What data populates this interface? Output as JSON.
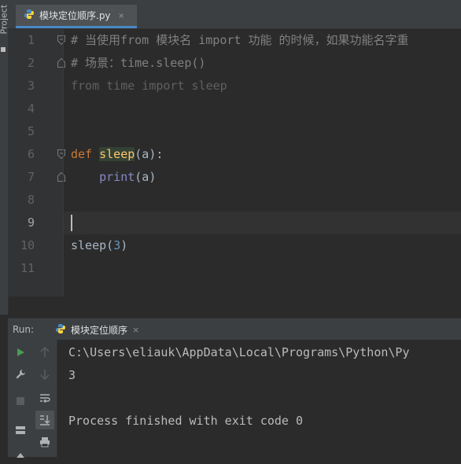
{
  "sidebar": {
    "project_label": "Project"
  },
  "tabs": [
    {
      "label": "模块定位顺序.py",
      "close": "×"
    }
  ],
  "editor": {
    "line_numbers": [
      "1",
      "2",
      "3",
      "4",
      "5",
      "6",
      "7",
      "8",
      "9",
      "10",
      "11"
    ],
    "current_line": "9",
    "lines": {
      "l1": "# 当使用from 模块名 import 功能 的时候，如果功能名字重",
      "l2": "# 场景：time.sleep()",
      "l3": "from time import sleep",
      "l6_def": "def",
      "l6_name": "sleep",
      "l6_rest": "(a):",
      "l7_indent": "    ",
      "l7_print": "print",
      "l7_rest": "(a)",
      "l10_call": "sleep(",
      "l10_arg": "3",
      "l10_close": ")"
    }
  },
  "run_panel": {
    "label": "Run:",
    "tab_label": "模块定位顺序",
    "tab_close": "×",
    "output": [
      "C:\\Users\\eliauk\\AppData\\Local\\Programs\\Python\\Py",
      "3",
      "",
      "Process finished with exit code 0"
    ]
  },
  "colors": {
    "background": "#2b2b2b",
    "keyword": "#cc7832",
    "comment": "#808080",
    "function_name": "#ffc66d",
    "builtin": "#8888c6",
    "number": "#6897bb",
    "text": "#a9b7c6",
    "run_green": "#499c54"
  },
  "icons": [
    "python-file-icon",
    "close-icon",
    "fold-start-icon",
    "fold-end-icon",
    "run-icon",
    "wrench-icon",
    "stop-icon",
    "layout-icon",
    "pin-icon",
    "up-arrow-icon",
    "down-arrow-icon",
    "soft-wrap-icon",
    "scroll-to-end-icon",
    "print-icon"
  ]
}
